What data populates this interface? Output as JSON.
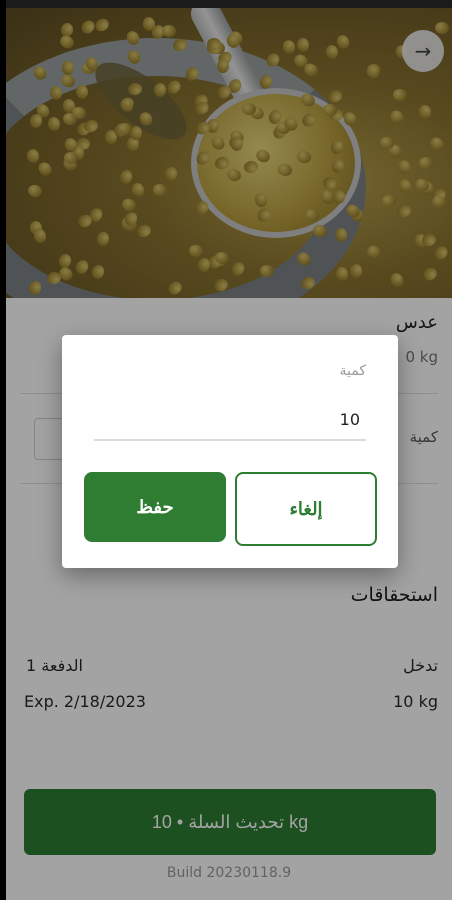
{
  "product": {
    "name": "عدس",
    "unit_amount": "0 kg",
    "quantity_label": "كمية"
  },
  "entitlements": {
    "heading": "استحقاقات",
    "entry_label": "تدخل",
    "entry_value": "10 kg",
    "batch_label": "الدفعة 1",
    "batch_expiry": "Exp. 2/18/2023"
  },
  "footer": {
    "update_cart_label": "تحديث السلة • 10 kg",
    "build": "Build 20230118.9"
  },
  "dialog": {
    "field_label": "كمية",
    "field_value": "10",
    "save_label": "حفظ",
    "cancel_label": "إلغاء"
  },
  "icons": {
    "back": "arrow-right-icon"
  },
  "colors": {
    "primary": "#2e7d32"
  }
}
